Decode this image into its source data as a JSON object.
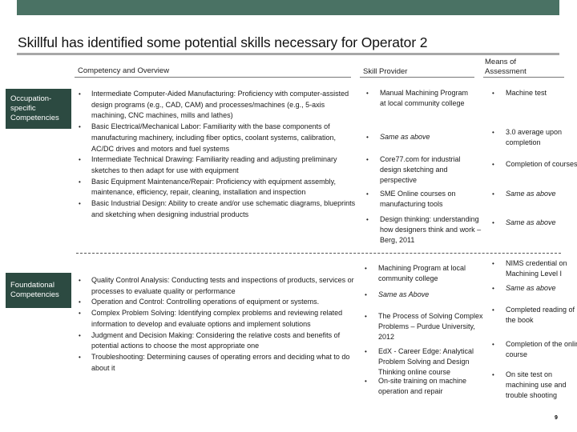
{
  "slide": {
    "title": "Skillful has identified some potential skills necessary for Operator 2",
    "page_number": "9"
  },
  "columns": {
    "competency": "Competency and Overview",
    "provider": "Skill Provider",
    "assessment_line1": "Means of",
    "assessment_line2": "Assessment"
  },
  "colors": {
    "header_bar": "#4a7264",
    "label_box": "#2c4a41",
    "rule": "#a7a7a7"
  },
  "sections": {
    "occupation": {
      "label": "Occupation-specific Competencies",
      "competencies": [
        "Intermediate Computer-Aided Manufacturing: Proficiency with computer-assisted design programs (e.g., CAD, CAM) and processes/machines (e.g., 5-axis machining, CNC machines, mills and lathes)",
        "Basic Electrical/Mechanical Labor: Familiarity with the base components of manufacturing machinery, including fiber optics, coolant systems, calibration, AC/DC drives and motors and fuel systems",
        "Intermediate Technical Drawing: Familiarity reading and adjusting preliminary sketches to then adapt for use with equipment",
        "Basic Equipment Maintenance/Repair: Proficiency with equipment assembly, maintenance, efficiency, repair, cleaning, installation and inspection",
        "Basic Industrial Design: Ability to create and/or use schematic diagrams, blueprints and sketching when designing industrial products"
      ],
      "providers": [
        "Manual Machining Program at local community college",
        "Same as above",
        "Core77.com for industrial design sketching and perspective",
        "SME Online courses on manufacturing tools",
        "Design thinking: understanding how designers think and work – Berg, 2011"
      ],
      "assessments": [
        "Machine test",
        "3.0 average upon completion",
        "Completion of courses",
        "Same as above",
        "Same as above"
      ]
    },
    "foundational": {
      "label": "Foundational Competencies",
      "competencies": [
        "Quality Control Analysis: Conducting tests and inspections of products, services or processes to evaluate quality or performance",
        "Operation and Control: Controlling operations of equipment or systems.",
        "Complex Problem Solving: Identifying complex problems and reviewing related information to develop and evaluate options and implement solutions",
        "Judgment and Decision Making: Considering the relative costs and benefits of potential actions to choose the most appropriate one",
        "Troubleshooting: Determining causes of operating errors and deciding what to do about it"
      ],
      "providers": [
        "Machining Program at local community college",
        "Same as Above",
        "The Process of Solving Complex Problems – Purdue University, 2012",
        "EdX - Career Edge: Analytical Problem Solving and Design Thinking online course",
        "On-site training on machine operation and repair"
      ],
      "assessments": [
        "NIMS credential on Machining Level I",
        "Same as above",
        "Completed reading of the book",
        "Completion of the online course",
        "On site test on machining use and trouble shooting"
      ]
    }
  }
}
